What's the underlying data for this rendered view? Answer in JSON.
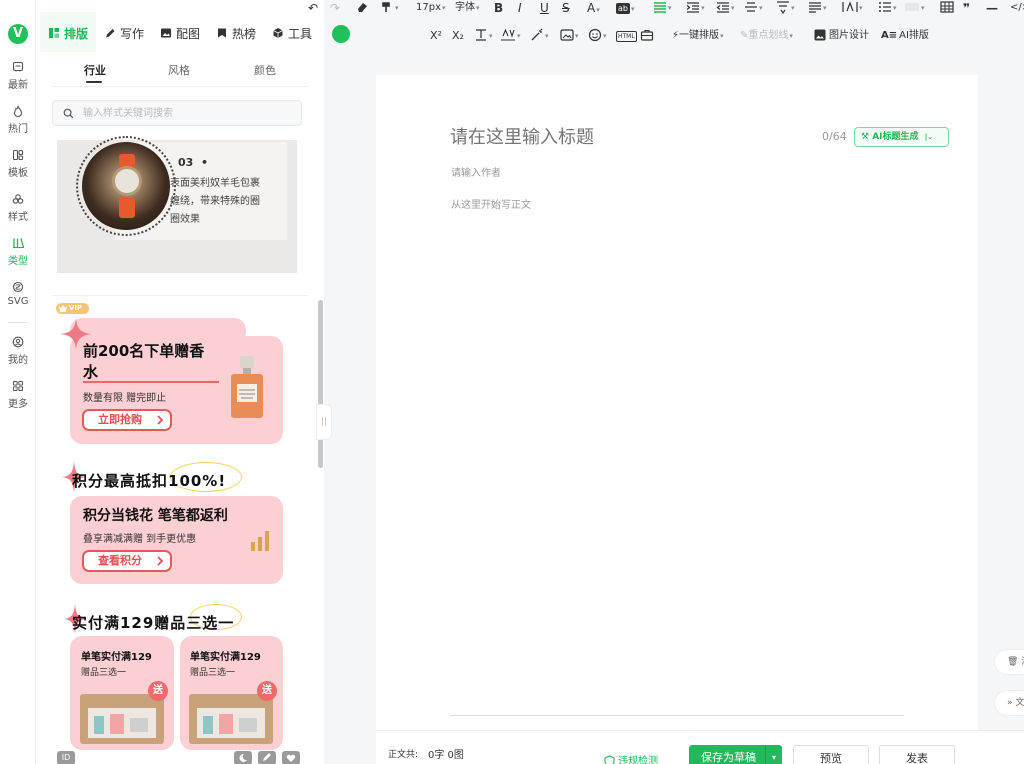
{
  "rail": {
    "logo": "V",
    "items": [
      {
        "label": "最新",
        "icon": "news-icon"
      },
      {
        "label": "热门",
        "icon": "fire-icon"
      },
      {
        "label": "模板",
        "icon": "template-icon"
      },
      {
        "label": "样式",
        "icon": "style-icon"
      },
      {
        "label": "类型",
        "icon": "type-icon"
      },
      {
        "label": "SVG",
        "icon": "svg-icon"
      },
      {
        "label": "我的",
        "icon": "user-icon"
      },
      {
        "label": "更多",
        "icon": "more-icon"
      }
    ]
  },
  "nav": {
    "tabs": [
      {
        "label": "排版",
        "icon": "layout-icon"
      },
      {
        "label": "写作",
        "icon": "pen-icon"
      },
      {
        "label": "配图",
        "icon": "image-icon"
      },
      {
        "label": "热榜",
        "icon": "bookmark-icon"
      },
      {
        "label": "工具",
        "icon": "cube-icon"
      }
    ]
  },
  "panel": {
    "subtabs": [
      "行业",
      "风格",
      "颜色"
    ],
    "search_placeholder": "输入样式关键词搜索",
    "card1": {
      "number": "03",
      "desc_lines": [
        "表面美利奴羊毛包裹",
        "缠绕，带来特殊的圈",
        "圈效果"
      ]
    },
    "vip": "VIP",
    "promo1": {
      "title_line1": "前200名下单赠香",
      "title_line2": "水",
      "desc": "数量有限 赠完即止",
      "button": "立即抢购"
    },
    "promo2": {
      "heading": "积分最高抵扣100%!",
      "title": "积分当钱花 笔笔都返利",
      "desc": "叠享满减满赠 到手更优惠",
      "button": "查看积分"
    },
    "promo3": {
      "heading": "实付满129赠品三选一",
      "card_title": "单笔实付满129",
      "card_sub": "赠品三选一",
      "badge": "送"
    },
    "bottom_icon_label": "ID"
  },
  "toolbar": {
    "font_size": "17px",
    "font_family": "字体",
    "row2": {
      "superscript": "X²",
      "subscript": "X₂",
      "one_click_layout": "一键排版",
      "underline_key": "重点划线",
      "image_design": "图片设计",
      "ai_layout": "AI排版"
    }
  },
  "editor": {
    "title_placeholder": "请在这里输入标题",
    "title_count": "0/64",
    "ai_title_button": "AI标题生成",
    "author_placeholder": "请输入作者",
    "body_placeholder": "从这里开始写正文"
  },
  "footer": {
    "word_count_label": "正文共:",
    "word_count_value": "0字 0图",
    "violation_check": "违规检测",
    "save_draft": "保存为草稿",
    "preview": "预览",
    "publish": "发表"
  },
  "side": {
    "clear_label": "清",
    "text_label": "文"
  },
  "colors": {
    "brand_green": "#20b756",
    "promo_pink": "#fcd0d2",
    "promo_red": "#e05050"
  }
}
